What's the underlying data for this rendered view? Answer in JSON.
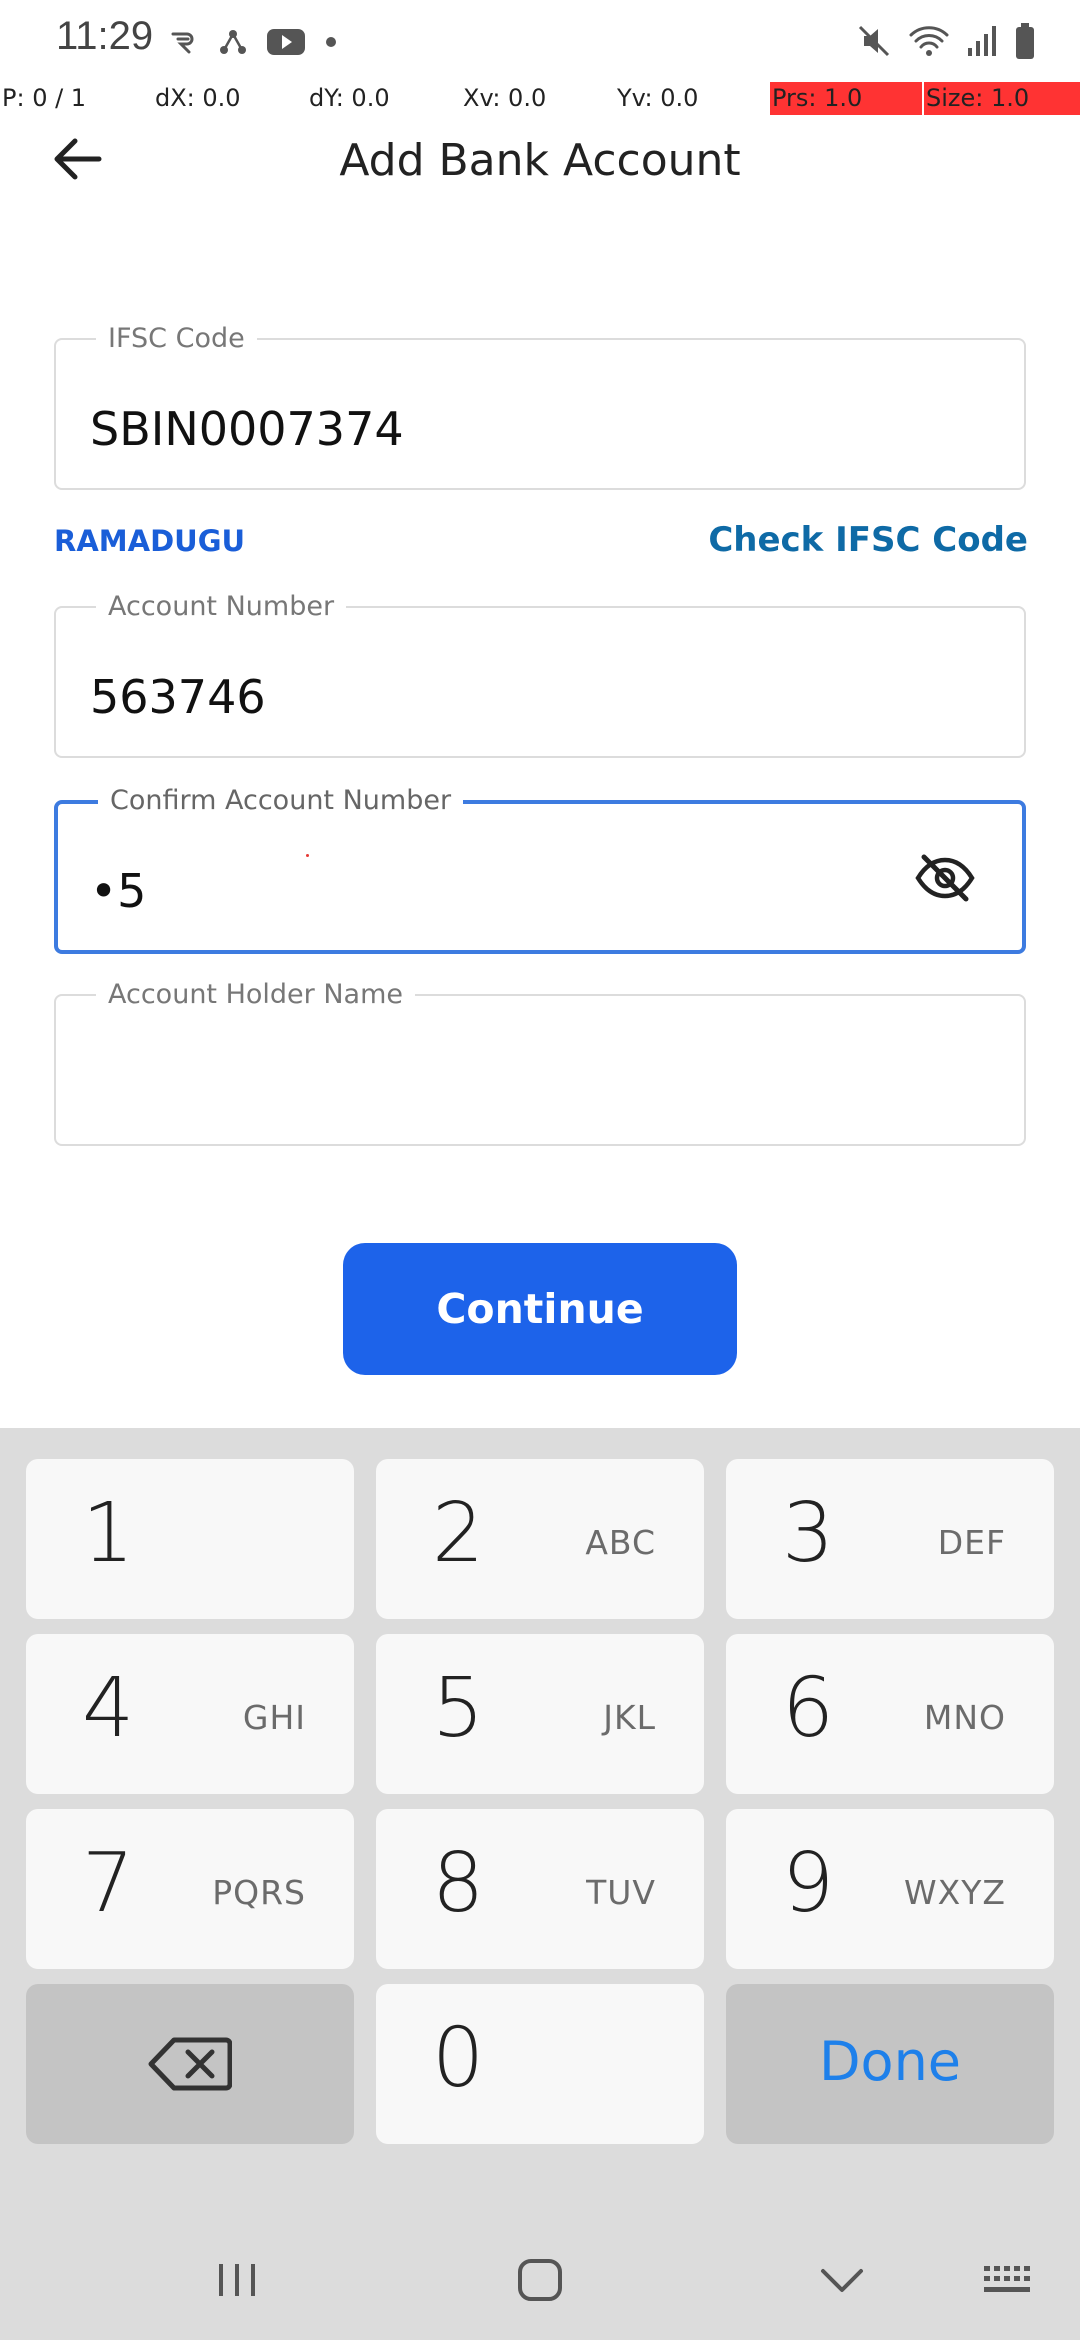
{
  "status_bar": {
    "time": "11:29",
    "left_icons": [
      "reddit-like-icon",
      "share-icon",
      "youtube-icon",
      "dot-icon"
    ],
    "right_icons": [
      "mute-icon",
      "wifi-icon",
      "signal-icon",
      "battery-icon"
    ]
  },
  "pointer_overlay": {
    "p": "P: 0 / 1",
    "dx": "dX: 0.0",
    "dy": "dY: 0.0",
    "xv": "Xv: 0.0",
    "yv": "Yv: 0.0",
    "prs": "Prs: 1.0",
    "size": "Size: 1.0",
    "highlight_color": "#ff3333"
  },
  "app_bar": {
    "title": "Add Bank Account",
    "back_icon": "arrow-left-icon"
  },
  "form": {
    "ifsc": {
      "label": "IFSC Code",
      "value": "SBIN0007374"
    },
    "branch_name": "RAMADUGU",
    "check_ifsc_label": "Check IFSC Code",
    "account_number": {
      "label": "Account Number",
      "value": "563746"
    },
    "confirm_account_number": {
      "label": "Confirm Account Number",
      "value": "•5",
      "visibility_icon": "eye-off-icon"
    },
    "account_holder_name": {
      "label": "Account Holder Name",
      "value": ""
    },
    "continue_label": "Continue",
    "accent_color": "#1d63ea"
  },
  "keyboard": {
    "rows": [
      [
        {
          "num": "1",
          "letters": ""
        },
        {
          "num": "2",
          "letters": "ABC"
        },
        {
          "num": "3",
          "letters": "DEF"
        }
      ],
      [
        {
          "num": "4",
          "letters": "GHI"
        },
        {
          "num": "5",
          "letters": "JKL"
        },
        {
          "num": "6",
          "letters": "MNO"
        }
      ],
      [
        {
          "num": "7",
          "letters": "PQRS"
        },
        {
          "num": "8",
          "letters": "TUV"
        },
        {
          "num": "9",
          "letters": "WXYZ"
        }
      ]
    ],
    "zero": "0",
    "done_label": "Done",
    "backspace_icon": "backspace-icon"
  },
  "nav_bar": {
    "icons": [
      "recent-apps-icon",
      "home-icon",
      "hide-keyboard-icon",
      "keyboard-switch-icon"
    ]
  }
}
